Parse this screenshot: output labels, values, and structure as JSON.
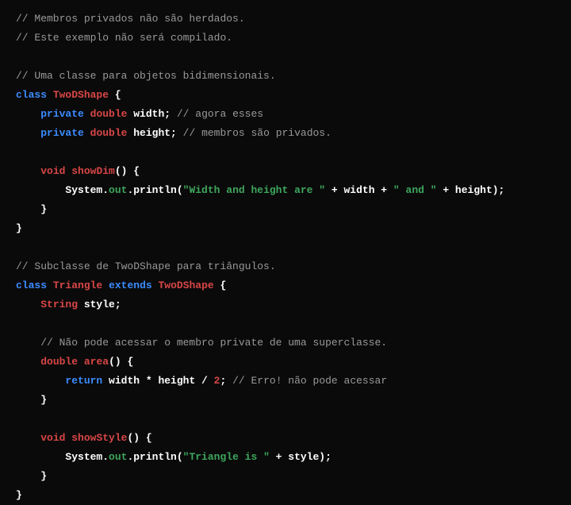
{
  "code": {
    "comment1": "// Membros privados não são herdados.",
    "comment2": "// Este exemplo não será compilado.",
    "comment3": "// Uma classe para objetos bidimensionais.",
    "kw_class1": "class",
    "cn_twodshape1": "TwoDShape",
    "brace_open1": " {",
    "kw_private1": "private",
    "type_double1": "double",
    "field_width": " width;",
    "comment_width": " // agora esses",
    "kw_private2": "private",
    "type_double2": "double",
    "field_height": " height;",
    "comment_height": " // membros são privados.",
    "type_void1": "void",
    "method_showdim": "showDim",
    "parens_open1": "() {",
    "sys_out1": "        System.",
    "out1": "out",
    "dot_println1": ".println(",
    "str_whah": "\"Width and height are \"",
    "plus_width": " + width + ",
    "str_and": "\" and \"",
    "plus_height": " + height);",
    "brace_close1": "    }",
    "brace_close2": "}",
    "comment4": "// Subclasse de TwoDShape para triângulos.",
    "kw_class2": "class",
    "cn_triangle": "Triangle",
    "kw_extends": "extends",
    "cn_twodshape2": "TwoDShape",
    "brace_open2": " {",
    "type_string": "String",
    "field_style": " style;",
    "comment5": "    // Não pode acessar o membro private de uma superclasse.",
    "type_double3": "double",
    "method_area": "area",
    "parens_open2": "() {",
    "kw_return": "return",
    "expr_wh": " width * height / ",
    "num_2": "2",
    "semicolon": ";",
    "comment_erro": " // Erro! não pode acessar",
    "brace_close3": "    }",
    "type_void2": "void",
    "method_showstyle": "showStyle",
    "parens_open3": "() {",
    "sys_out2": "        System.",
    "out2": "out",
    "dot_println2": ".println(",
    "str_triangle": "\"Triangle is \"",
    "plus_style": " + style);",
    "brace_close4": "    }",
    "brace_close5": "}"
  }
}
